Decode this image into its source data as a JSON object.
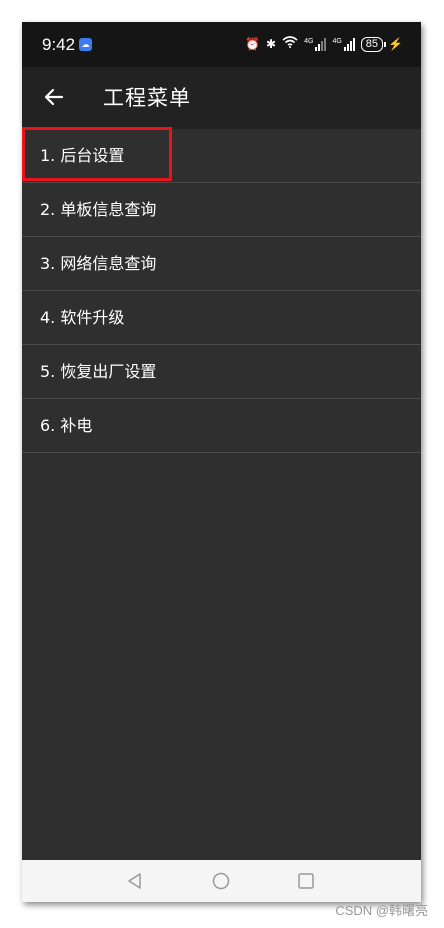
{
  "status_bar": {
    "time": "9:42",
    "app_icon": "cloud-app-icon",
    "network_1": "4G",
    "network_2": "4G",
    "battery": "85"
  },
  "title_bar": {
    "title": "工程菜单",
    "back_icon": "arrow-left-icon"
  },
  "menu": {
    "items": [
      {
        "label": "1. 后台设置"
      },
      {
        "label": "2. 单板信息查询"
      },
      {
        "label": "3. 网络信息查询"
      },
      {
        "label": "4. 软件升级"
      },
      {
        "label": "5. 恢复出厂设置"
      },
      {
        "label": "6. 补电"
      }
    ]
  },
  "colors": {
    "status_bar_bg": "#151515",
    "title_bar_bg": "#222222",
    "list_bg": "#2f2f2f",
    "highlight_border": "#e8131b",
    "nav_bar_bg": "#f5f5f5"
  },
  "watermark": "CSDN @韩曙亮"
}
